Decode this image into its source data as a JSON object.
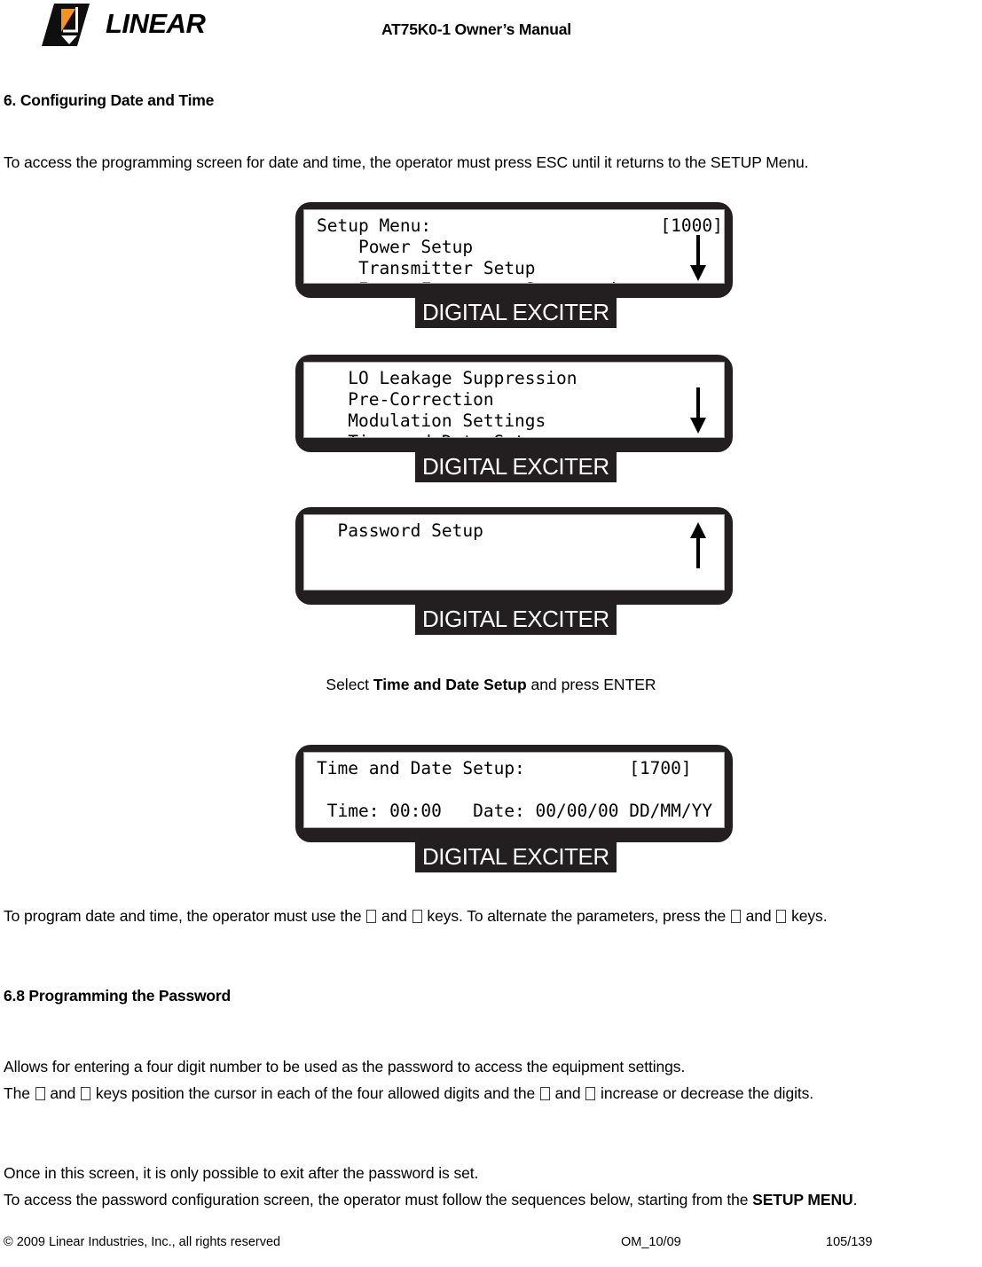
{
  "header": {
    "logo_text": "LINEAR",
    "logo_colors": {
      "dark": "#100f10",
      "accent": "#F5931E",
      "white": "#ffffff"
    },
    "title": "AT75K0-1 Owner’s Manual"
  },
  "section": {
    "heading": "6. Configuring Date and Time",
    "intro": "To access the programming screen for date and time, the operator must press ESC until it returns to the SETUP Menu."
  },
  "panels": [
    {
      "id": "setup-menu",
      "badge": "DIGITAL EXCITER",
      "arrow": "down-arrow-icon",
      "lines": [
        "Setup Menu:                      [1000]",
        "    Power Setup",
        "    Transmitter Setup",
        "    Image Frequency Suppression"
      ]
    },
    {
      "id": "lo-leakage-menu",
      "badge": "DIGITAL EXCITER",
      "arrow": "down-arrow-icon",
      "lines": [
        "   LO Leakage Suppression",
        "   Pre-Correction",
        "   Modulation Settings",
        "-> Time and Date Setup"
      ]
    },
    {
      "id": "password-setup-menu",
      "badge": "DIGITAL EXCITER",
      "arrow": "up-arrow-icon",
      "lines": [
        "  Password Setup",
        "",
        "",
        ""
      ]
    },
    {
      "id": "time-date-setup",
      "badge": "DIGITAL EXCITER",
      "arrow": "none",
      "lines": [
        "Time and Date Setup:          [1700]",
        "",
        " Time: 00:00   Date: 00/00/00 DD/MM/YY",
        ""
      ]
    }
  ],
  "caption": {
    "prefix": "Select ",
    "bold": "Time and Date Setup",
    "suffix": " and press ENTER"
  },
  "notes": {
    "program_line_a": "To program date and time, the operator must use the ",
    "program_line_b": " and ",
    "program_line_c": " keys. To alternate the parameters, press the ",
    "program_line_d": " and ",
    "program_line_e": " keys."
  },
  "password_section": {
    "heading": "6.8 Programming the Password",
    "p1": "Allows for entering a four digit number to be used as the password to access the equipment settings.",
    "p2_a": "The ",
    "p2_b": " and ",
    "p2_c": " keys position the cursor in each of the four allowed digits and the ",
    "p2_d": " and ",
    "p2_e": " increase or decrease the digits.",
    "p3": "Once in this screen, it is only possible to exit after the password is set.",
    "p4_a": "To access the password configuration screen, the operator must follow the sequences below, starting from the ",
    "p4_bold": "SETUP MENU",
    "p4_b": "."
  },
  "footer": {
    "copyright": "© 2009 Linear Industries, Inc., all rights reserved",
    "doc_code": "OM_10/09",
    "page": "105/139"
  }
}
